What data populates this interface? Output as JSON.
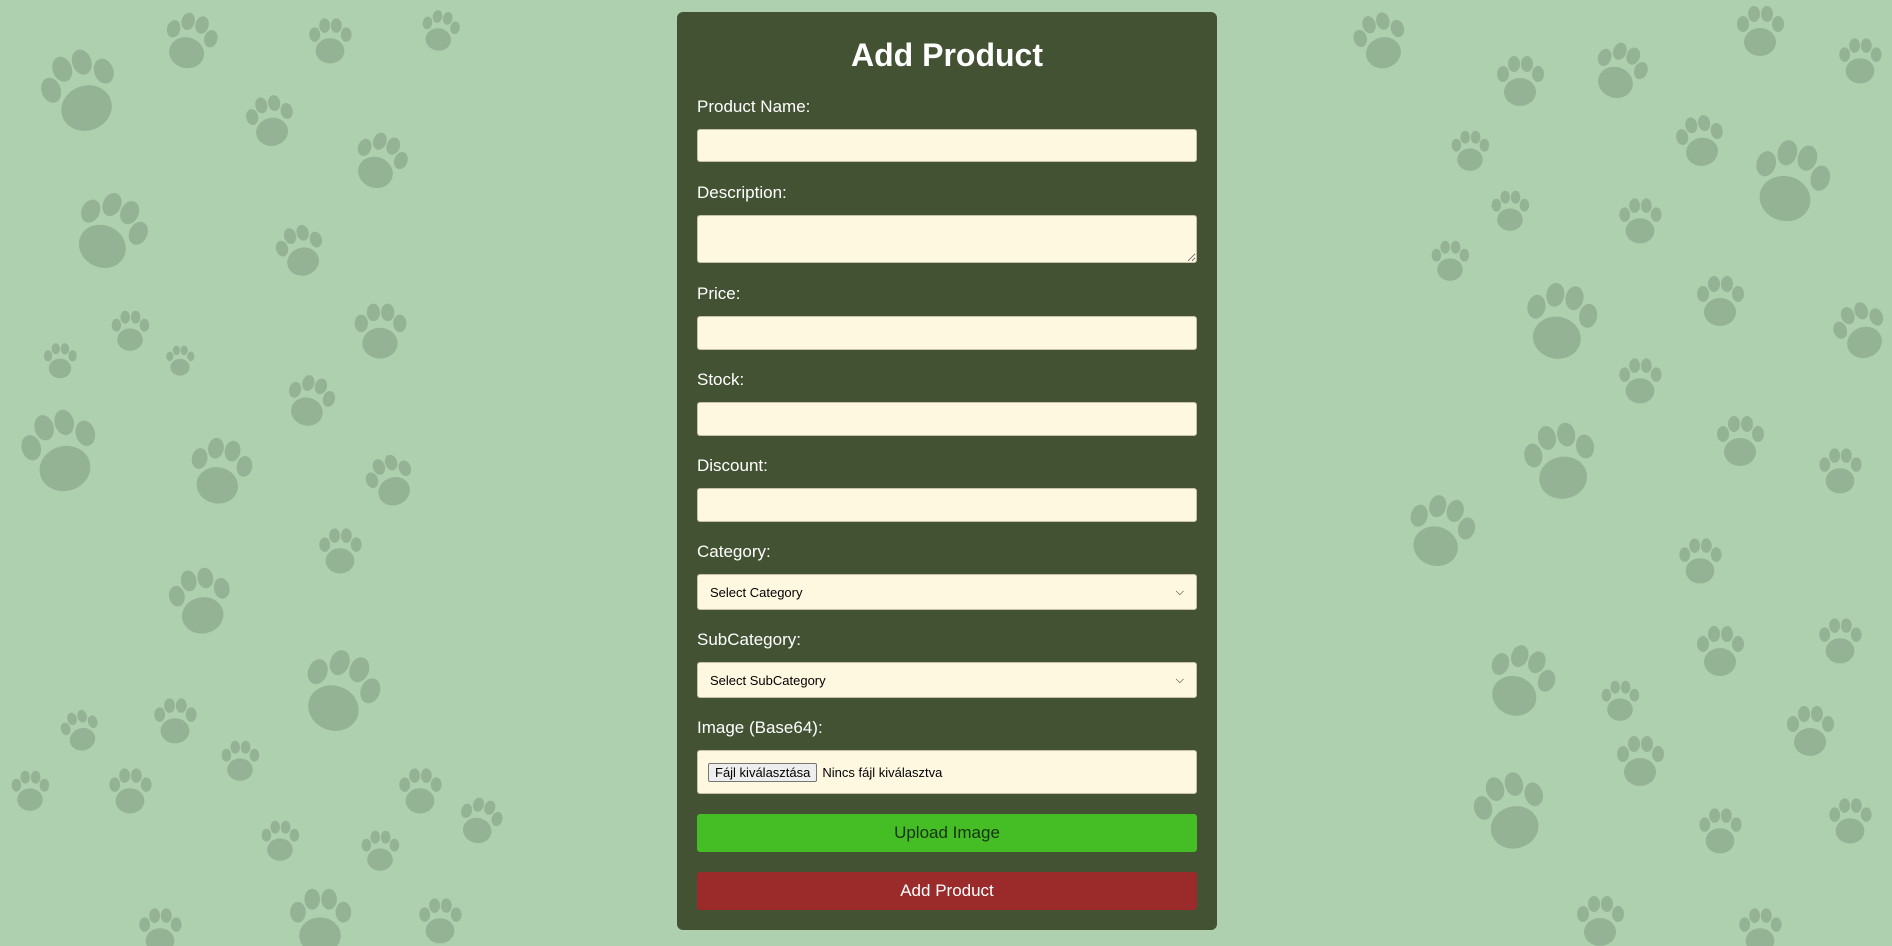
{
  "page": {
    "background_color": "#afd0af",
    "card_color": "#425233"
  },
  "form": {
    "title": "Add Product",
    "product_name": {
      "label": "Product Name:",
      "value": ""
    },
    "description": {
      "label": "Description:",
      "value": ""
    },
    "price": {
      "label": "Price:",
      "value": ""
    },
    "stock": {
      "label": "Stock:",
      "value": ""
    },
    "discount": {
      "label": "Discount:",
      "value": ""
    },
    "category": {
      "label": "Category:",
      "selected": "Select Category"
    },
    "subcategory": {
      "label": "SubCategory:",
      "selected": "Select SubCategory"
    },
    "image": {
      "label": "Image (Base64):",
      "choose_button": "Fájl kiválasztása",
      "status": "Nincs fájl kiválasztva"
    },
    "upload_button": "Upload Image",
    "submit_button": "Add Product"
  },
  "colors": {
    "input_bg": "#fff8e1",
    "upload_button": "#45bd24",
    "submit_button": "#9b2a2a",
    "paw_print": "#7f9a7e"
  },
  "icons": {
    "select_arrow": "chevron-down-icon",
    "background_pattern": "paw-print-icon"
  }
}
